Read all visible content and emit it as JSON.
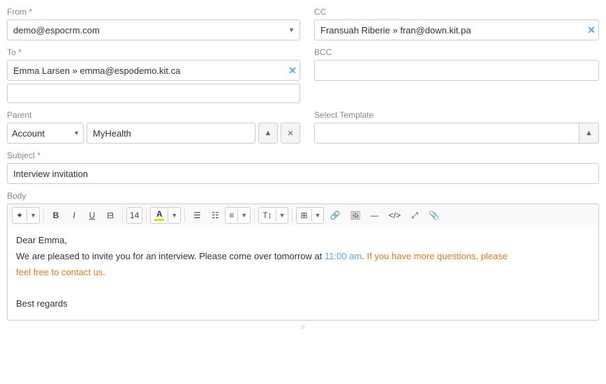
{
  "form": {
    "from_label": "From *",
    "from_value": "demo@espocrm.com",
    "cc_label": "CC",
    "cc_tag_name": "Fransuah Riberie",
    "cc_tag_arrow": "»",
    "cc_tag_email": "fran@down.kit.pa",
    "to_label": "To *",
    "to_tag_name": "Emma Larsen",
    "to_tag_arrow": "»",
    "to_tag_email": "emma@espodemo.kit.ca",
    "bcc_label": "BCC",
    "parent_label": "Parent",
    "parent_type": "Account",
    "parent_value": "MyHealth",
    "select_template_label": "Select Template",
    "subject_label": "Subject *",
    "subject_value": "Interview invitation",
    "body_label": "Body",
    "toolbar": {
      "magic_label": "✦",
      "bold_label": "B",
      "italic_label": "I",
      "underline_label": "U",
      "format_label": "⊟",
      "font_size": "14",
      "highlight_letter": "A",
      "list_ul": "☰",
      "list_ol": "☷",
      "align_label": "≡",
      "text_t": "T↕",
      "table_label": "⊞",
      "link_label": "🔗",
      "image_label": "🖼",
      "hr_label": "—",
      "code_label": "</>",
      "fullscreen_label": "⤢",
      "attach_label": "📎"
    },
    "body_content": {
      "line1": "Dear Emma,",
      "line2_part1": "We are pleased to invite you for an interview. Please come over tomorrow at ",
      "line2_time": "11:00 am",
      "line2_part2": ". ",
      "line2_part3": "If you have more questions, please",
      "line3": "feel free to contact us.",
      "line4": "Best regards"
    }
  }
}
